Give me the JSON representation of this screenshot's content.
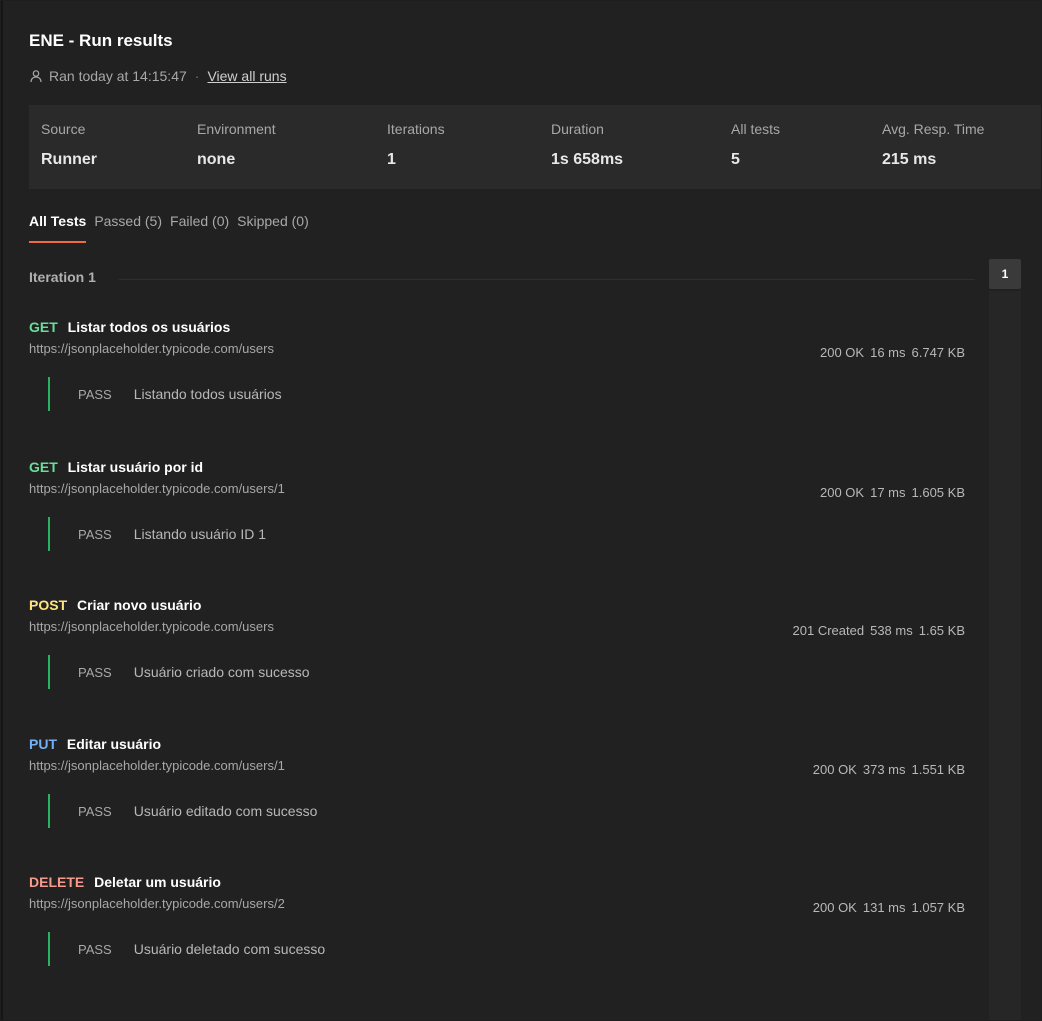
{
  "header": {
    "title": "ENE - Run results",
    "ran_text": "Ran today at 14:15:47",
    "separator": "·",
    "view_all": "View all runs"
  },
  "summary": [
    {
      "label": "Source",
      "value": "Runner"
    },
    {
      "label": "Environment",
      "value": "none"
    },
    {
      "label": "Iterations",
      "value": "1"
    },
    {
      "label": "Duration",
      "value": "1s 658ms"
    },
    {
      "label": "All tests",
      "value": "5"
    },
    {
      "label": "Avg. Resp. Time",
      "value": "215 ms"
    }
  ],
  "tabs": [
    {
      "label": "All Tests",
      "active": true
    },
    {
      "label": "Passed (5)"
    },
    {
      "label": "Failed (0)"
    },
    {
      "label": "Skipped (0)"
    }
  ],
  "iteration": {
    "label": "Iteration 1",
    "badge": "1"
  },
  "requests": [
    {
      "method": "GET",
      "name": "Listar todos os usuários",
      "url": "https://jsonplaceholder.typicode.com/users",
      "status": "200 OK",
      "time": "16 ms",
      "size": "6.747 KB",
      "test_status": "PASS",
      "test_name": "Listando todos usuários"
    },
    {
      "method": "GET",
      "name": "Listar usuário por id",
      "url": "https://jsonplaceholder.typicode.com/users/1",
      "status": "200 OK",
      "time": "17 ms",
      "size": "1.605 KB",
      "test_status": "PASS",
      "test_name": "Listando usuário ID 1"
    },
    {
      "method": "POST",
      "name": "Criar novo usuário",
      "url": "https://jsonplaceholder.typicode.com/users",
      "status": "201 Created",
      "time": "538 ms",
      "size": "1.65 KB",
      "test_status": "PASS",
      "test_name": "Usuário criado com sucesso"
    },
    {
      "method": "PUT",
      "name": "Editar usuário",
      "url": "https://jsonplaceholder.typicode.com/users/1",
      "status": "200 OK",
      "time": "373 ms",
      "size": "1.551 KB",
      "test_status": "PASS",
      "test_name": "Usuário editado com sucesso"
    },
    {
      "method": "DELETE",
      "name": "Deletar um usuário",
      "url": "https://jsonplaceholder.typicode.com/users/2",
      "status": "200 OK",
      "time": "131 ms",
      "size": "1.057 KB",
      "test_status": "PASS",
      "test_name": "Usuário deletado com sucesso"
    }
  ],
  "colors": {
    "get": "#6bdd9a",
    "post": "#ffe47e",
    "put": "#74aef6",
    "delete": "#f79a8e",
    "pass_bar": "#27b35f",
    "active_tab": "#f26b3a"
  }
}
